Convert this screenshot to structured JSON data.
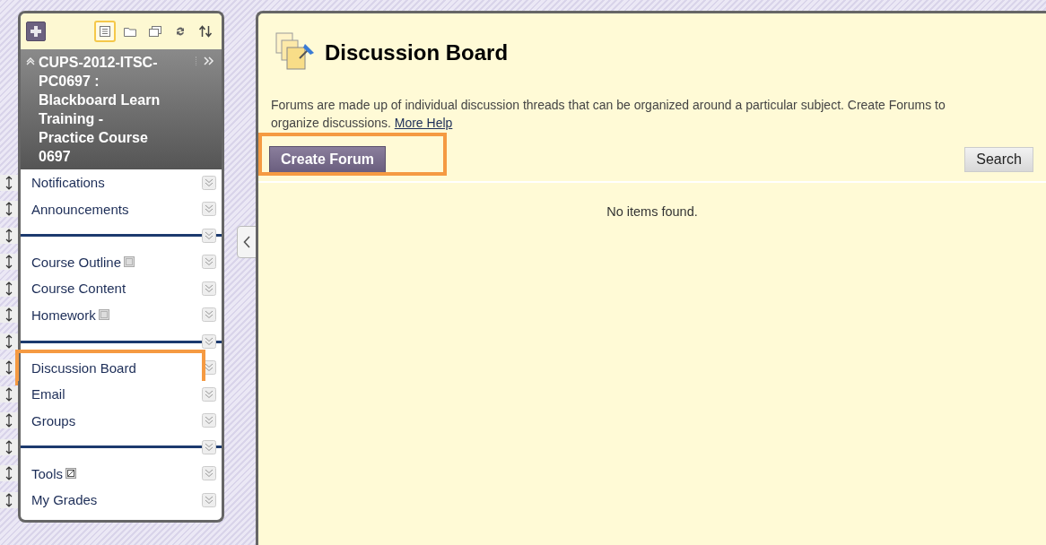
{
  "sidebar": {
    "toolbar": [
      {
        "kind": "list",
        "selected": true
      },
      {
        "kind": "folder",
        "selected": false
      },
      {
        "kind": "windows",
        "selected": false
      },
      {
        "kind": "refresh",
        "selected": false
      },
      {
        "kind": "sort",
        "selected": false
      }
    ],
    "course_title": "CUPS-2012-ITSC-PC0697 : Blackboard Learn Training - Practice Course 0697",
    "items": [
      {
        "kind": "link",
        "label": "Notifications",
        "hidden": false,
        "unavailable": false,
        "highlighted": false
      },
      {
        "kind": "link",
        "label": "Announcements",
        "hidden": false,
        "unavailable": false,
        "highlighted": false
      },
      {
        "kind": "divider"
      },
      {
        "kind": "link",
        "label": "Course Outline",
        "hidden": true,
        "unavailable": false,
        "highlighted": false
      },
      {
        "kind": "link",
        "label": "Course Content",
        "hidden": false,
        "unavailable": false,
        "highlighted": false
      },
      {
        "kind": "link",
        "label": "Homework",
        "hidden": true,
        "unavailable": false,
        "highlighted": false
      },
      {
        "kind": "divider"
      },
      {
        "kind": "link",
        "label": "Discussion Board",
        "hidden": false,
        "unavailable": false,
        "highlighted": true
      },
      {
        "kind": "link",
        "label": "Email",
        "hidden": false,
        "unavailable": false,
        "highlighted": false
      },
      {
        "kind": "link",
        "label": "Groups",
        "hidden": false,
        "unavailable": false,
        "highlighted": false
      },
      {
        "kind": "divider"
      },
      {
        "kind": "link",
        "label": "Tools",
        "hidden": false,
        "unavailable": true,
        "highlighted": false
      },
      {
        "kind": "link",
        "label": "My Grades",
        "hidden": false,
        "unavailable": false,
        "highlighted": false
      }
    ]
  },
  "page": {
    "title": "Discussion Board",
    "description": "Forums are made up of individual discussion threads that can be organized around a particular subject. Create Forums to organize discussions.",
    "help_link": "More Help",
    "create_button": {
      "label": "Create Forum",
      "highlighted": true
    },
    "search_button": "Search",
    "empty_message": "No items found."
  }
}
